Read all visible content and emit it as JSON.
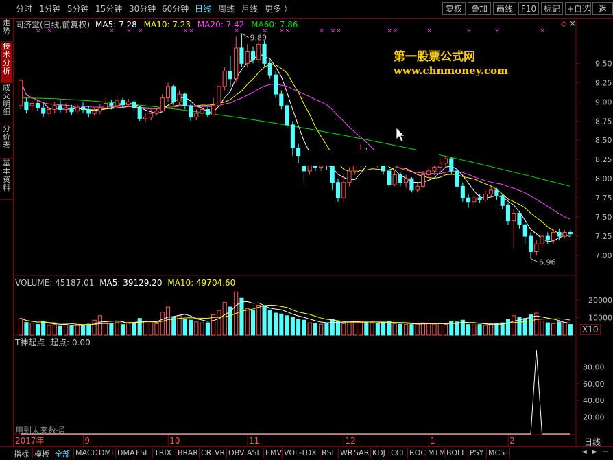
{
  "periods": [
    {
      "label": "分时",
      "active": false
    },
    {
      "label": "1分钟",
      "active": false
    },
    {
      "label": "5分钟",
      "active": false
    },
    {
      "label": "15分钟",
      "active": false
    },
    {
      "label": "30分钟",
      "active": false
    },
    {
      "label": "60分钟",
      "active": false
    },
    {
      "label": "日线",
      "active": true
    },
    {
      "label": "周线",
      "active": false
    },
    {
      "label": "月线",
      "active": false
    },
    {
      "label": "更多",
      "active": false
    }
  ],
  "more_arrow": "〉",
  "toolbar": {
    "fuquan": "复权",
    "diejia": "叠加",
    "huaxian": "画线",
    "f10": "F10",
    "biaoji": "标记",
    "zixuan": "+自选",
    "fan": "返"
  },
  "side_tabs": [
    {
      "label": "分时走势",
      "active": false
    },
    {
      "label": "技术分析",
      "active": true
    },
    {
      "label": "成交明细",
      "active": false
    },
    {
      "label": "分价表",
      "active": false
    },
    {
      "label": "基本资料",
      "active": false
    }
  ],
  "main_header": {
    "stock": "同济堂(日线,前复权)",
    "ma5": "MA5: 7.28",
    "ma10": "MA10: 7.23",
    "ma20": "MA20: 7.42",
    "ma60": "MA60: 7.86"
  },
  "colors": {
    "ma5": "#ffffff",
    "ma10": "#ffff00",
    "ma20": "#ff44ff",
    "ma60": "#00dd00",
    "up": "#ff5555",
    "down": "#54ffff",
    "grid": "#800000",
    "axis": "#c0c0c0"
  },
  "watermark": {
    "title": "第一股票公式网",
    "url": "www.chnmoney.com"
  },
  "price_axis": [
    "9.50",
    "9.25",
    "9.00",
    "8.75",
    "8.50",
    "8.25",
    "8.00",
    "7.75",
    "7.50",
    "7.25",
    "7.00"
  ],
  "high_label": "9.89",
  "low_label": "6.96",
  "volume_header": {
    "volume": "VOLUME: 45187.01",
    "ma5": "MA5: 39129.20",
    "ma10": "MA10: 49704.60"
  },
  "volume_axis": [
    "20000",
    "10000"
  ],
  "volume_unit": "X10",
  "indicator_header": {
    "name": "T神起点",
    "value": "起点: 0.00"
  },
  "indicator_axis": [
    "80.00",
    "60.00",
    "40.00",
    "20.00"
  ],
  "indicator_note": "用到未来数据",
  "date_axis": [
    "2017年",
    "9",
    "10",
    "11",
    "12",
    "1",
    "2"
  ],
  "period_label": "日线",
  "indicator_tabs": [
    "指标",
    "模板",
    "全部",
    "MACD",
    "DMI",
    "DMA",
    "FSL",
    "TRIX",
    "BRAR",
    "CR",
    "VR",
    "OBV",
    "ASI",
    "EMV",
    "VOL-TDX",
    "RSI",
    "WR",
    "SAR",
    "KDJ",
    "CCI",
    "ROC",
    "MTM",
    "BOLL",
    "PSY",
    "MCST"
  ],
  "indicator_tab_active": "全部",
  "candles": [
    [
      8.95,
      9.28,
      9.3,
      8.9
    ],
    [
      9.0,
      8.9,
      9.05,
      8.85
    ],
    [
      8.95,
      8.98,
      9.05,
      8.88
    ],
    [
      8.98,
      8.92,
      9.02,
      8.88
    ],
    [
      8.92,
      8.85,
      8.98,
      8.8
    ],
    [
      8.85,
      8.9,
      8.95,
      8.8
    ],
    [
      8.9,
      8.95,
      9.0,
      8.85
    ],
    [
      8.95,
      8.9,
      9.02,
      8.86
    ],
    [
      8.9,
      8.92,
      8.98,
      8.85
    ],
    [
      8.92,
      8.87,
      8.96,
      8.83
    ],
    [
      8.88,
      8.93,
      8.98,
      8.84
    ],
    [
      8.93,
      8.9,
      9.0,
      8.86
    ],
    [
      8.9,
      8.85,
      8.94,
      8.8
    ],
    [
      8.85,
      8.88,
      8.92,
      8.82
    ],
    [
      8.88,
      8.92,
      8.97,
      8.84
    ],
    [
      8.92,
      8.98,
      9.05,
      8.9
    ],
    [
      8.98,
      8.95,
      9.02,
      8.9
    ],
    [
      8.95,
      9.02,
      9.08,
      8.92
    ],
    [
      9.02,
      8.96,
      9.05,
      8.92
    ],
    [
      8.96,
      9.0,
      9.04,
      8.93
    ],
    [
      9.0,
      8.92,
      9.02,
      8.88
    ],
    [
      8.92,
      8.78,
      8.95,
      8.75
    ],
    [
      8.78,
      8.8,
      8.85,
      8.74
    ],
    [
      8.8,
      8.85,
      8.9,
      8.76
    ],
    [
      8.85,
      8.88,
      8.92,
      8.82
    ],
    [
      8.88,
      9.05,
      9.1,
      8.86
    ],
    [
      9.05,
      9.2,
      9.25,
      9.0
    ],
    [
      9.2,
      9.0,
      9.22,
      8.96
    ],
    [
      9.0,
      9.1,
      9.15,
      8.95
    ],
    [
      9.1,
      8.95,
      9.12,
      8.9
    ],
    [
      8.95,
      8.8,
      8.98,
      8.75
    ],
    [
      8.8,
      8.85,
      8.9,
      8.76
    ],
    [
      8.85,
      8.9,
      8.95,
      8.82
    ],
    [
      8.9,
      8.83,
      8.93,
      8.8
    ],
    [
      8.83,
      8.95,
      9.05,
      8.82
    ],
    [
      8.95,
      9.2,
      9.25,
      8.92
    ],
    [
      9.2,
      9.4,
      9.45,
      9.15
    ],
    [
      9.4,
      9.3,
      9.6,
      9.2
    ],
    [
      9.3,
      9.7,
      9.85,
      9.25
    ],
    [
      9.7,
      9.5,
      9.89,
      9.45
    ],
    [
      9.5,
      9.65,
      9.75,
      9.45
    ],
    [
      9.65,
      9.55,
      9.72,
      9.5
    ],
    [
      9.55,
      9.75,
      9.82,
      9.5
    ],
    [
      9.75,
      9.5,
      9.8,
      9.45
    ],
    [
      9.5,
      9.35,
      9.55,
      9.3
    ],
    [
      9.35,
      9.1,
      9.4,
      9.05
    ],
    [
      9.1,
      8.95,
      9.15,
      8.9
    ],
    [
      8.95,
      8.7,
      9.0,
      8.65
    ],
    [
      8.7,
      8.4,
      8.75,
      8.3
    ],
    [
      8.4,
      8.3,
      8.45,
      8.2
    ],
    [
      8.3,
      8.1,
      8.35,
      7.95
    ],
    [
      8.1,
      8.2,
      8.25,
      8.05
    ],
    [
      8.2,
      8.15,
      8.3,
      8.1
    ],
    [
      8.15,
      8.25,
      8.32,
      8.1
    ],
    [
      8.25,
      8.18,
      8.3,
      8.12
    ],
    [
      8.18,
      7.95,
      8.2,
      7.85
    ],
    [
      7.95,
      7.75,
      8.0,
      7.7
    ],
    [
      7.75,
      7.95,
      8.05,
      7.7
    ],
    [
      7.95,
      8.1,
      8.15,
      7.9
    ],
    [
      8.1,
      8.2,
      8.3,
      8.05
    ],
    [
      8.2,
      8.35,
      8.45,
      8.15
    ],
    [
      8.35,
      8.25,
      8.4,
      8.2
    ],
    [
      8.25,
      8.3,
      8.38,
      8.2
    ],
    [
      8.3,
      8.2,
      8.35,
      8.15
    ],
    [
      8.2,
      8.1,
      8.25,
      8.05
    ],
    [
      8.1,
      7.92,
      8.12,
      7.88
    ],
    [
      7.92,
      8.05,
      8.1,
      7.9
    ],
    [
      8.05,
      7.95,
      8.08,
      7.9
    ],
    [
      7.95,
      8.0,
      8.05,
      7.88
    ],
    [
      8.0,
      7.85,
      8.02,
      7.82
    ],
    [
      7.85,
      7.9,
      7.95,
      7.82
    ],
    [
      7.9,
      8.05,
      8.1,
      7.88
    ],
    [
      8.05,
      8.1,
      8.15,
      8.0
    ],
    [
      8.1,
      8.15,
      8.2,
      8.05
    ],
    [
      8.15,
      8.2,
      8.25,
      8.1
    ],
    [
      8.2,
      8.26,
      8.3,
      8.15
    ],
    [
      8.26,
      8.1,
      8.28,
      8.05
    ],
    [
      8.1,
      7.9,
      8.12,
      7.85
    ],
    [
      7.9,
      7.75,
      7.95,
      7.7
    ],
    [
      7.75,
      7.7,
      7.8,
      7.62
    ],
    [
      7.7,
      7.75,
      7.8,
      7.65
    ],
    [
      7.75,
      7.72,
      7.8,
      7.68
    ],
    [
      7.72,
      7.8,
      7.85,
      7.7
    ],
    [
      7.8,
      7.85,
      7.9,
      7.75
    ],
    [
      7.85,
      7.78,
      7.88,
      7.72
    ],
    [
      7.78,
      7.65,
      7.8,
      7.6
    ],
    [
      7.65,
      7.45,
      7.68,
      7.4
    ],
    [
      7.45,
      7.55,
      7.6,
      7.1
    ],
    [
      7.55,
      7.4,
      7.58,
      7.35
    ],
    [
      7.4,
      7.25,
      7.45,
      7.15
    ],
    [
      7.25,
      7.05,
      7.3,
      6.96
    ],
    [
      7.05,
      7.15,
      7.2,
      7.0
    ],
    [
      7.15,
      7.25,
      7.3,
      7.1
    ],
    [
      7.25,
      7.2,
      7.3,
      7.15
    ],
    [
      7.2,
      7.3,
      7.35,
      7.15
    ],
    [
      7.3,
      7.25,
      7.35,
      7.2
    ],
    [
      7.25,
      7.3,
      7.33,
      7.22
    ],
    [
      7.3,
      7.28,
      7.33,
      7.24
    ]
  ],
  "volumes": [
    9500,
    7200,
    6800,
    6000,
    8000,
    5500,
    6000,
    5000,
    5800,
    5200,
    6000,
    5500,
    6200,
    8500,
    11000,
    7000,
    6500,
    7500,
    6000,
    6800,
    7200,
    9500,
    8000,
    7500,
    6500,
    13000,
    16000,
    10000,
    11000,
    9000,
    8500,
    7500,
    7000,
    7000,
    11500,
    14000,
    18500,
    16000,
    24500,
    21000,
    15000,
    14000,
    17000,
    16500,
    14000,
    12500,
    12000,
    11000,
    10000,
    9000,
    8500,
    7000,
    6500,
    6200,
    7000,
    9000,
    8000,
    6500,
    7000,
    8000,
    8000,
    7500,
    7000,
    6500,
    7000,
    8000,
    6500,
    6200,
    6000,
    6000,
    6500,
    7000,
    6800,
    6200,
    6500,
    6000,
    8000,
    7500,
    8500,
    6000,
    5800,
    6000,
    5500,
    6200,
    6500,
    7000,
    9000,
    11000,
    10000,
    9500,
    11500,
    12500,
    8000,
    7000,
    6500,
    7500,
    7000,
    6000
  ],
  "indicator_values": [
    0,
    0,
    0,
    0,
    0,
    0,
    0,
    0,
    0,
    0,
    0,
    0,
    0,
    0,
    0,
    0,
    0,
    0,
    0,
    0,
    0,
    0,
    0,
    0,
    0,
    0,
    0,
    0,
    0,
    0,
    0,
    0,
    0,
    0,
    0,
    0,
    0,
    0,
    0,
    0,
    0,
    0,
    0,
    0,
    0,
    0,
    0,
    0,
    0,
    0,
    0,
    0,
    0,
    0,
    0,
    0,
    0,
    0,
    0,
    0,
    0,
    0,
    0,
    0,
    0,
    0,
    0,
    0,
    0,
    0,
    0,
    0,
    0,
    0,
    0,
    0,
    0,
    0,
    0,
    0,
    0,
    0,
    0,
    0,
    0,
    0,
    0,
    0,
    0,
    0,
    0,
    100,
    0,
    0,
    0,
    0,
    0,
    0
  ]
}
